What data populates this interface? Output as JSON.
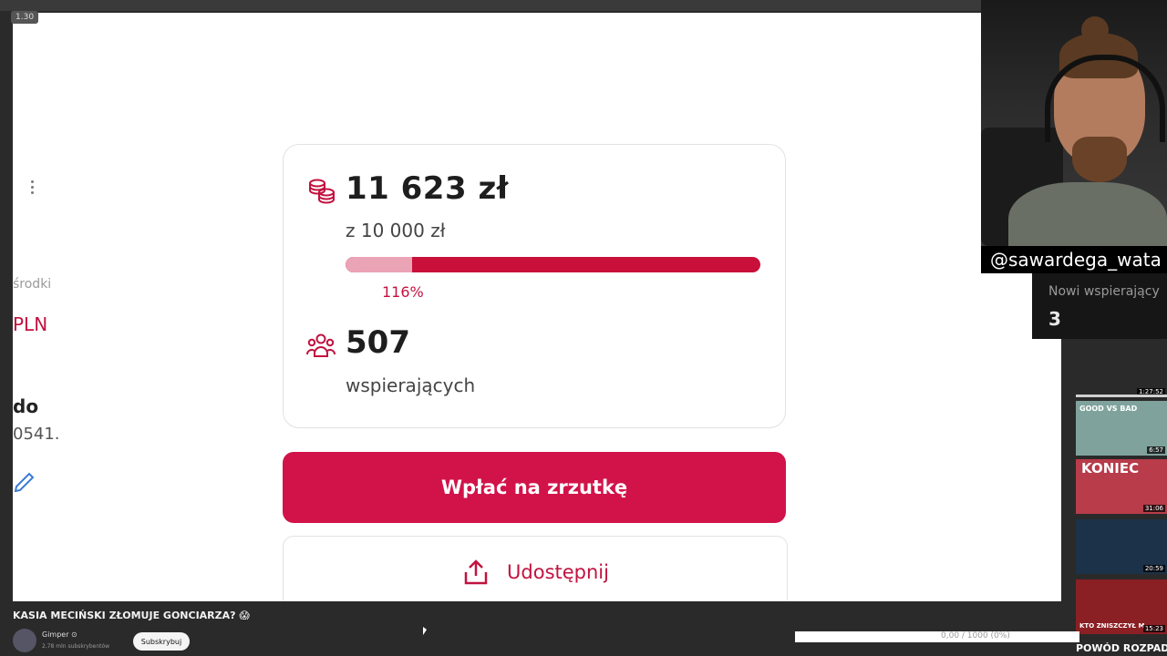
{
  "stream": {
    "badge": "1.30"
  },
  "sidebar": {
    "text_a": "środki",
    "text_b": "PLN",
    "text_c": "do",
    "text_d": "0541."
  },
  "fundraiser": {
    "raised": "11 623 zł",
    "goal": "z 10 000 zł",
    "progress_percent": 116,
    "progress_label": "116%",
    "supporters_count": "507",
    "supporters_label": "wspierających",
    "donate_label": "Wpłać na zrzutkę",
    "share_label": "Udostępnij"
  },
  "overlay": {
    "handle": "@sawardega_wata",
    "new_supporters_label": "Nowi wspierający",
    "new_supporters_value": "3"
  },
  "thumbnails": [
    {
      "title": "",
      "duration": "1:27:52"
    },
    {
      "title": "GOOD VS BAD",
      "duration": "6:57"
    },
    {
      "title": "KONIEC",
      "duration": "31:06"
    },
    {
      "title": "",
      "duration": "20:59"
    },
    {
      "title": "KTO ZNISZCZYŁ M",
      "duration": "15:23"
    }
  ],
  "video": {
    "title": "KASIA MECIŃSKI ZŁOMUJE GONCIARZA? 😱",
    "channel": "Gimper ⊙",
    "subscribers": "2,78 mln subskrybentów",
    "subscribe_label": "Subskrybuj",
    "progress_text": "0,00 / 1000 (0%)",
    "bottom_title": "POWÓD ROZPADU"
  },
  "colors": {
    "accent": "#d2134a",
    "bar_track": "#c8103a",
    "bar_fill": "#eba3b6"
  }
}
